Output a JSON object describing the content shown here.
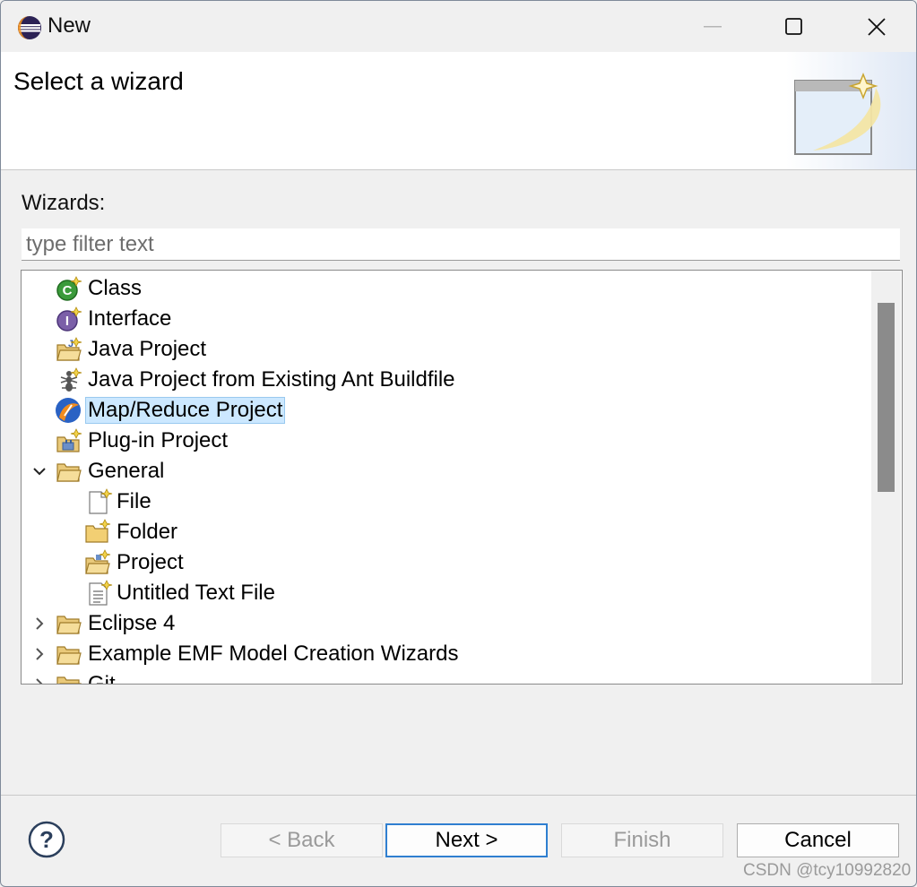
{
  "window": {
    "title": "New",
    "app_icon": "eclipse-icon"
  },
  "header": {
    "title": "Select a wizard",
    "banner_icon": "wizard-banner-icon"
  },
  "wizards_label": "Wizards:",
  "filter": {
    "placeholder": "type filter text",
    "value": ""
  },
  "tree": {
    "items": [
      {
        "label": "Class",
        "icon": "class-icon",
        "selected": false
      },
      {
        "label": "Interface",
        "icon": "interface-icon",
        "selected": false
      },
      {
        "label": "Java Project",
        "icon": "java-project-icon",
        "selected": false
      },
      {
        "label": "Java Project from Existing Ant Buildfile",
        "icon": "ant-icon",
        "selected": false
      },
      {
        "label": "Map/Reduce Project",
        "icon": "mapreduce-icon",
        "selected": true
      },
      {
        "label": "Plug-in Project",
        "icon": "plugin-project-icon",
        "selected": false
      },
      {
        "label": "General",
        "icon": "folder-icon",
        "expanded": true,
        "children": [
          {
            "label": "File",
            "icon": "new-file-icon"
          },
          {
            "label": "Folder",
            "icon": "new-folder-icon"
          },
          {
            "label": "Project",
            "icon": "new-project-icon"
          },
          {
            "label": "Untitled Text File",
            "icon": "text-file-icon"
          }
        ]
      },
      {
        "label": "Eclipse 4",
        "icon": "folder-icon",
        "expanded": false
      },
      {
        "label": "Example EMF Model Creation Wizards",
        "icon": "folder-icon",
        "expanded": false
      },
      {
        "label": "Git",
        "icon": "folder-icon",
        "expanded": false
      }
    ]
  },
  "buttons": {
    "back": "< Back",
    "next": "Next >",
    "finish": "Finish",
    "cancel": "Cancel"
  },
  "watermark": "CSDN @tcy10992820",
  "colors": {
    "selection": "#cce8ff",
    "default_button_border": "#2f7fd0",
    "scroll_thumb": "#8b8b8b"
  }
}
